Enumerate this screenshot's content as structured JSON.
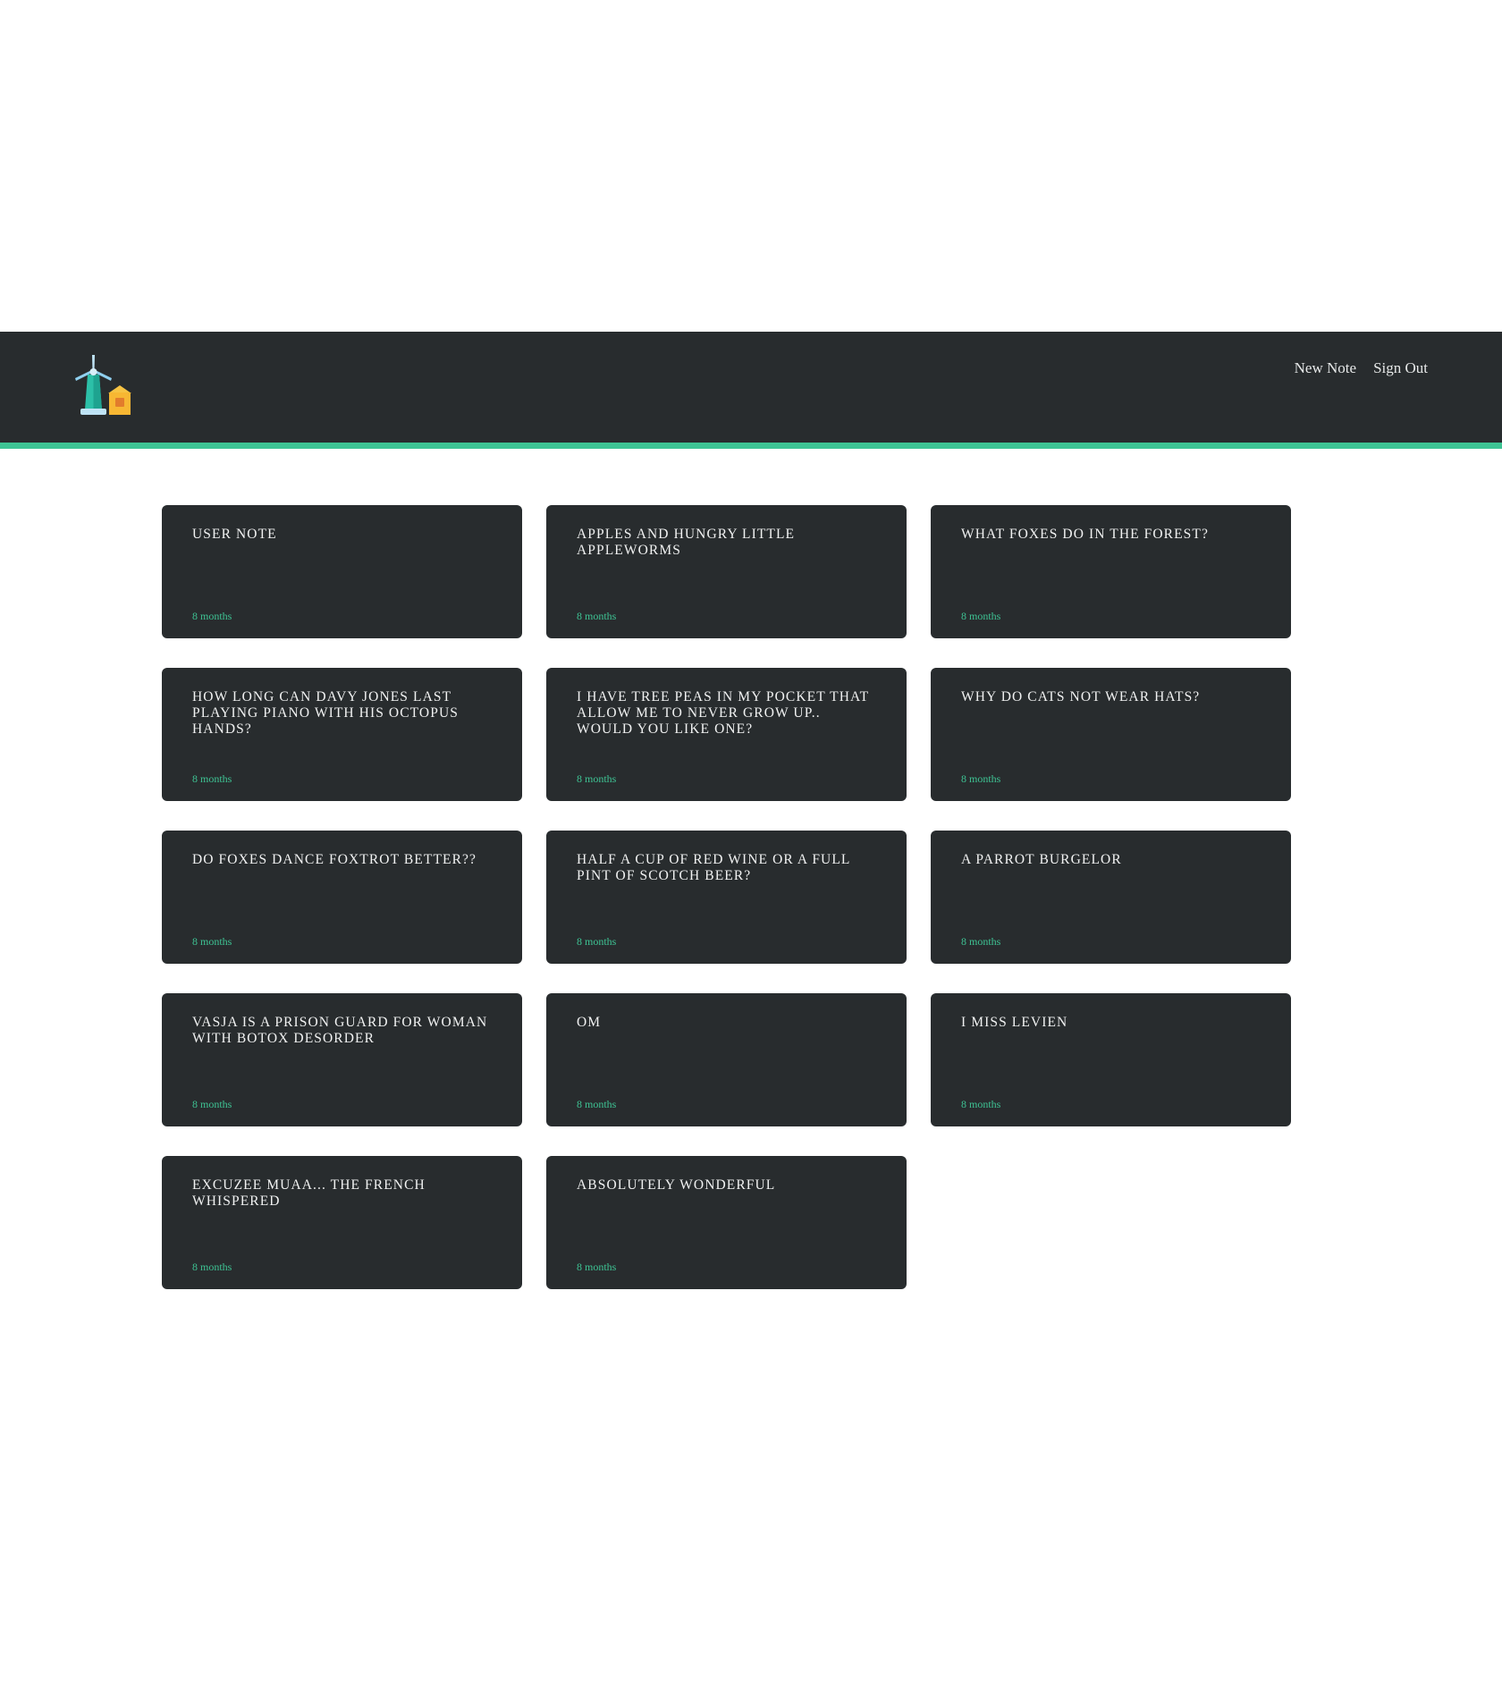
{
  "header": {
    "logo_icon": "windmill-house-icon",
    "nav": [
      {
        "label": "New Note"
      },
      {
        "label": "Sign Out"
      }
    ]
  },
  "colors": {
    "header_bg": "#282c2e",
    "accent": "#3ec494",
    "card_bg": "#282c2e"
  },
  "notes": [
    {
      "title": "USER NOTE",
      "time": "8 months"
    },
    {
      "title": "APPLES AND HUNGRY LITTLE APPLEWORMS",
      "time": "8 months"
    },
    {
      "title": "WHAT FOXES DO IN THE FOREST?",
      "time": "8 months"
    },
    {
      "title": "HOW LONG CAN DAVY JONES LAST PLAYING PIANO WITH HIS OCTOPUS HANDS?",
      "time": "8 months"
    },
    {
      "title": "I HAVE TREE PEAS IN MY POCKET THAT ALLOW ME TO NEVER GROW UP.. WOULD YOU LIKE ONE?",
      "time": "8 months"
    },
    {
      "title": "WHY DO CATS NOT WEAR HATS?",
      "time": "8 months"
    },
    {
      "title": "DO FOXES DANCE FOXTROT BETTER??",
      "time": "8 months"
    },
    {
      "title": "HALF A CUP OF RED WINE OR A FULL PINT OF SCOTCH BEER?",
      "time": "8 months"
    },
    {
      "title": "A PARROT BURGELOR",
      "time": "8 months"
    },
    {
      "title": "VASJA IS A PRISON GUARD FOR WOMAN WITH BOTOX DESORDER",
      "time": "8 months"
    },
    {
      "title": "OM",
      "time": "8 months"
    },
    {
      "title": "I MISS LEVIEN",
      "time": "8 months"
    },
    {
      "title": "EXCUZEE MUAA... THE FRENCH WHISPERED",
      "time": "8 months"
    },
    {
      "title": "ABSOLUTELY WONDERFUL",
      "time": "8 months"
    }
  ]
}
